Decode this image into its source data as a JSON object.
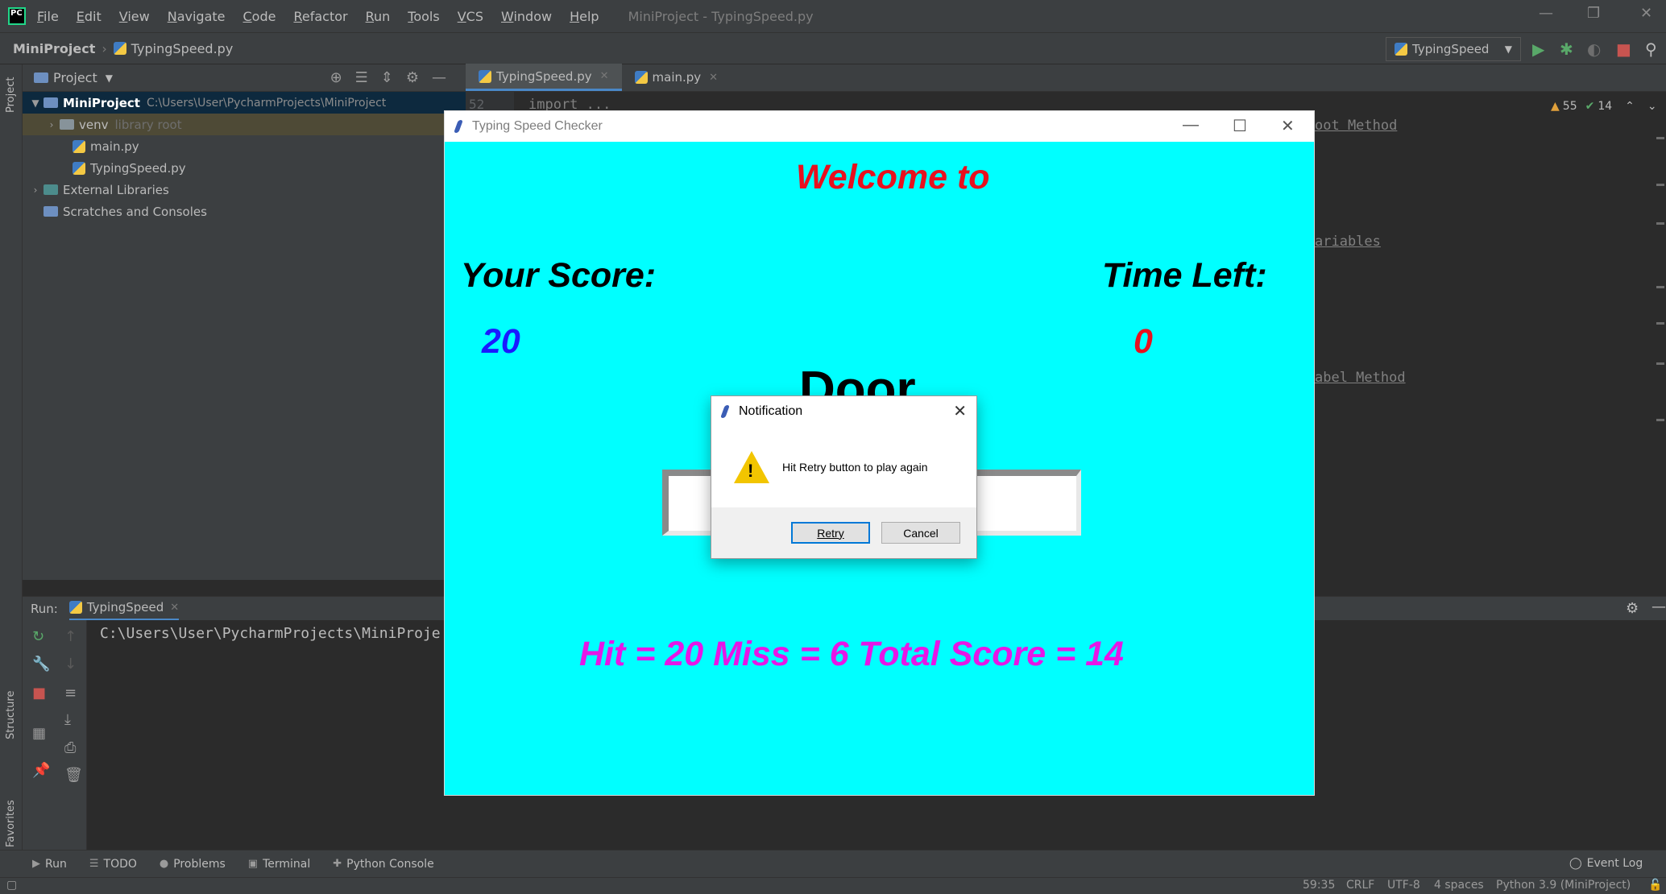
{
  "menubar": {
    "items": [
      "File",
      "Edit",
      "View",
      "Navigate",
      "Code",
      "Refactor",
      "Run",
      "Tools",
      "VCS",
      "Window",
      "Help"
    ],
    "window_title": "MiniProject - TypingSpeed.py"
  },
  "navbar": {
    "project": "MiniProject",
    "file": "TypingSpeed.py",
    "run_config": "TypingSpeed"
  },
  "project_panel": {
    "header": "Project",
    "tree": [
      {
        "label": "MiniProject",
        "extra": "C:\\Users\\User\\PycharmProjects\\MiniProject"
      },
      {
        "label": "venv",
        "extra": "library root"
      },
      {
        "label": "main.py"
      },
      {
        "label": "TypingSpeed.py"
      },
      {
        "label": "External Libraries"
      },
      {
        "label": "Scratches and Consoles"
      }
    ]
  },
  "editor": {
    "tabs": [
      "TypingSpeed.py",
      "main.py"
    ],
    "line_number": "52",
    "first_line": "import ...",
    "fragments": [
      "oot Method",
      "ariables",
      "abel Method"
    ],
    "warnings": "55",
    "checks": "14"
  },
  "side_labels": {
    "project": "Project",
    "structure": "Structure",
    "favorites": "Favorites"
  },
  "run_panel": {
    "label": "Run:",
    "tab": "TypingSpeed",
    "output": "C:\\Users\\User\\PycharmProjects\\MiniProje"
  },
  "tool_tabs": [
    "Run",
    "TODO",
    "Problems",
    "Terminal",
    "Python Console"
  ],
  "event_log": "Event Log",
  "status": {
    "position": "59:35",
    "line_sep": "CRLF",
    "encoding": "UTF-8",
    "indent": "4 spaces",
    "interpreter": "Python 3.9 (MiniProject)"
  },
  "tk_app": {
    "title": "Typing Speed Checker",
    "welcome": "Welcome to",
    "score_label": "Your Score:",
    "time_label": "Time Left:",
    "score_value": "20",
    "time_value": "0",
    "word": "Door",
    "summary": "Hit = 20  Miss = 6  Total Score = 14",
    "colors": {
      "background": "#00ffff",
      "welcome": "#e8101e",
      "score": "#1a1aff",
      "time": "#e8101e",
      "summary": "#e616e6"
    }
  },
  "dialog": {
    "title": "Notification",
    "message": "Hit Retry button to play again",
    "retry": "Retry",
    "cancel": "Cancel"
  }
}
